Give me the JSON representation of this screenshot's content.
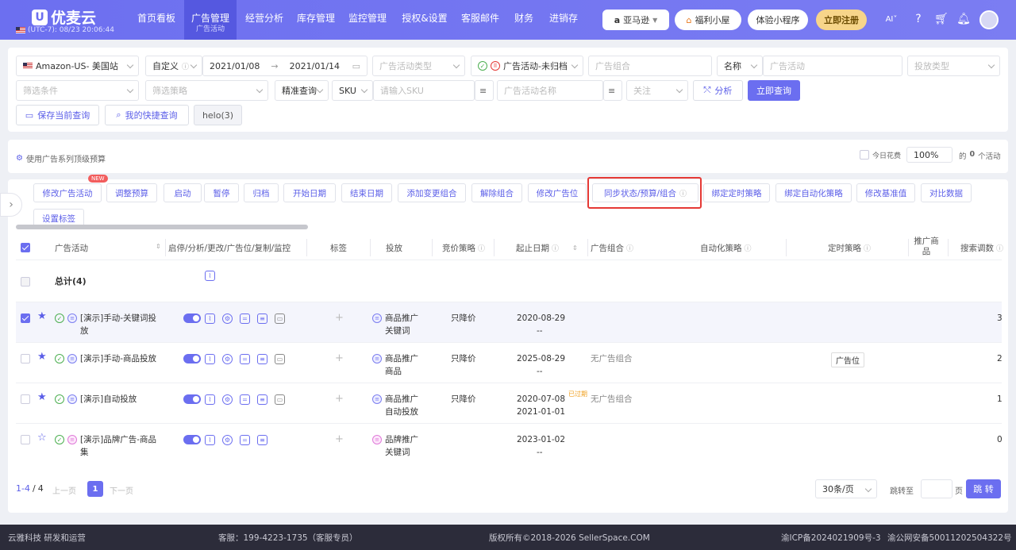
{
  "app": {
    "name": "优麦云",
    "timezone": "(UTC-7): 08/23 20:06:44"
  },
  "nav": {
    "items": [
      "首页看板",
      "广告管理",
      "经营分析",
      "库存管理",
      "监控管理",
      "授权&设置",
      "客服邮件",
      "财务",
      "进销存"
    ],
    "active_sub": "广告活动",
    "market": "亚马逊",
    "welfare": "福利小屋",
    "miniapp": "体验小程序",
    "register": "立即注册",
    "ai": "AI"
  },
  "filters": {
    "site": "Amazon-US- 美国站",
    "date_mode": "自定义",
    "date_start": "2021/01/08",
    "date_end": "2021/01/14",
    "campaign_type_ph": "广告活动类型",
    "campaign_status": "广告活动-未归档",
    "portfolio_ph": "广告组合",
    "name_label": "名称",
    "name_ph": "广告活动",
    "delivery_type_ph": "投放类型",
    "condition_ph": "筛选条件",
    "strategy_ph": "筛选策略",
    "match_mode": "精准查询",
    "sku_label": "SKU",
    "sku_ph": "请输入SKU",
    "campaign_name_ph": "广告活动名称",
    "follow_ph": "关注",
    "analyze": "分析",
    "query": "立即查询",
    "save_query": "保存当前查询",
    "my_queries": "我的快捷查询",
    "saved_tag": "helo(3)"
  },
  "budget": {
    "label": "使用广告系列顶级预算",
    "today_spend": "今日花费",
    "percent": "100%",
    "count_prefix": "的",
    "count": "0",
    "count_suffix": "个活动"
  },
  "actions": {
    "new_badge": "NEW",
    "buttons": [
      "修改广告活动",
      "调整预算",
      "启动",
      "暂停",
      "归档",
      "开始日期",
      "结束日期",
      "添加变更组合",
      "解除组合",
      "修改广告位",
      "同步状态/预算/组合",
      "绑定定时策略",
      "绑定自动化策略",
      "修改基准值",
      "对比数据"
    ],
    "set_tag": "设置标签"
  },
  "table": {
    "headers": [
      "广告活动",
      "启停/分析/更改/广告位/复制/监控",
      "标签",
      "投放",
      "竞价策略",
      "起止日期",
      "广告组合",
      "自动化策略",
      "定时策略",
      "推广商品",
      "搜索调数"
    ],
    "total_label": "总计(4)",
    "rows": [
      {
        "name": "[演示]手动-关键词投放",
        "delivery": "商品推广关键词",
        "bid": "只降价",
        "start": "2020-08-29",
        "end": "--",
        "portfolio": "",
        "timer": "",
        "tail": "3",
        "expired": ""
      },
      {
        "name": "[演示]手动-商品投放",
        "delivery": "商品推广商品",
        "bid": "只降价",
        "start": "2025-08-29",
        "end": "--",
        "portfolio": "无广告组合",
        "timer": "广告位",
        "tail": "2",
        "expired": ""
      },
      {
        "name": "[演示]自动投放",
        "delivery": "商品推广自动投放",
        "bid": "只降价",
        "start": "2020-07-08",
        "end": "2021-01-01",
        "portfolio": "无广告组合",
        "timer": "",
        "tail": "1",
        "expired": "已过期"
      },
      {
        "name": "[演示]品牌广告-商品集",
        "delivery": "品牌推广关键词",
        "bid": "",
        "start": "2023-01-02",
        "end": "--",
        "portfolio": "",
        "timer": "",
        "tail": "0",
        "expired": ""
      }
    ]
  },
  "pagination": {
    "range": "1-4",
    "total": "4",
    "prev": "上一页",
    "page": "1",
    "next": "下一页",
    "page_size": "30条/页",
    "jump_label": "跳转至",
    "page_unit": "页",
    "jump_btn": "跳 转"
  },
  "footer": {
    "company": "云雅科技 研发和运营",
    "support": "客服：199-4223-1735（客服专员）",
    "copyright": "版权所有©2018-2026 SellerSpace.COM",
    "icp": "渝ICP备2024021909号-3",
    "police": "渝公网安备50011202504322号"
  }
}
